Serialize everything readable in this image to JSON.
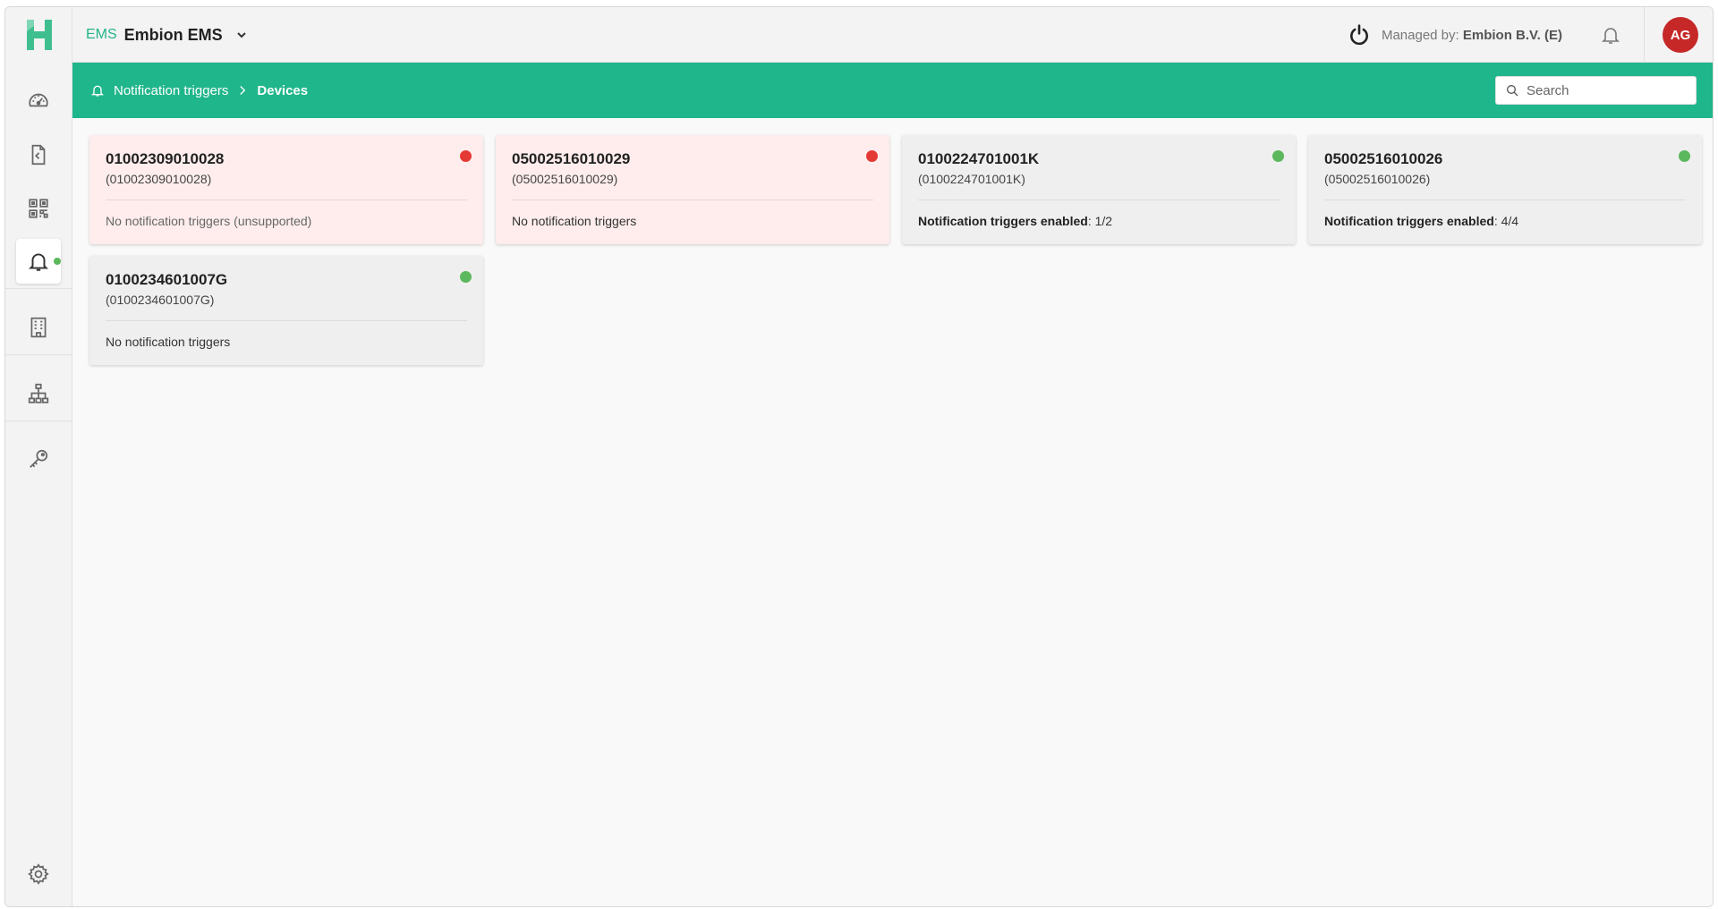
{
  "colors": {
    "accent": "#20b68b",
    "error_dot": "#e53935",
    "ok_dot": "#5cb85c",
    "avatar_bg": "#c62828"
  },
  "app": {
    "tag": "EMS",
    "name": "Embion EMS"
  },
  "topbar": {
    "managed_label": "Managed by:",
    "managed_value": "Embion B.V. (E)",
    "avatar_initials": "AG"
  },
  "breadcrumb": {
    "parent": "Notification triggers",
    "current": "Devices"
  },
  "search": {
    "placeholder": "Search",
    "value": ""
  },
  "sidebar": {
    "items": [
      {
        "name": "dashboard",
        "icon": "gauge-icon"
      },
      {
        "name": "reports",
        "icon": "document-icon"
      },
      {
        "name": "widgets",
        "icon": "qr-grid-icon"
      },
      {
        "name": "notifications",
        "icon": "bell-icon",
        "active": true
      },
      {
        "name": "buildings",
        "icon": "building-icon"
      },
      {
        "name": "hierarchy",
        "icon": "sitemap-icon"
      },
      {
        "name": "keys",
        "icon": "key-icon"
      },
      {
        "name": "settings",
        "icon": "gear-icon"
      }
    ]
  },
  "devices": [
    {
      "title": "01002309010028",
      "subtitle": "(01002309010028)",
      "status": "No notification triggers (unsupported)",
      "state": "error"
    },
    {
      "title": "05002516010029",
      "subtitle": "(05002516010029)",
      "status": "No notification triggers",
      "state": "error"
    },
    {
      "title": "0100224701001K",
      "subtitle": "(0100224701001K)",
      "status_label": "Notification triggers enabled",
      "status_value": ": 1/2",
      "state": "ok"
    },
    {
      "title": "05002516010026",
      "subtitle": "(05002516010026)",
      "status_label": "Notification triggers enabled",
      "status_value": ": 4/4",
      "state": "ok"
    },
    {
      "title": "0100234601007G",
      "subtitle": "(0100234601007G)",
      "status": "No notification triggers",
      "state": "ok"
    }
  ]
}
